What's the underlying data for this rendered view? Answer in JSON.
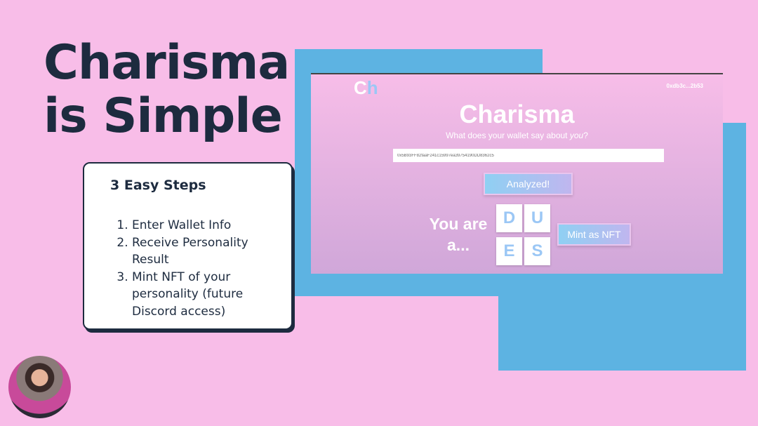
{
  "slide": {
    "title_line1": "Charisma",
    "title_line2": "is Simple",
    "steps_heading": "3 Easy Steps",
    "steps": [
      "Enter Wallet Info",
      "Receive Personality Result",
      "Mint NFT of your personality (future Discord access)"
    ]
  },
  "app": {
    "logo_c": "C",
    "logo_h": "h",
    "wallet_address": "0xdb3c...2b53",
    "title": "Charisma",
    "subtitle_prefix": "What does your wallet say about ",
    "subtitle_em": "you",
    "subtitle_suffix": "?",
    "wallet_input_value": "0x5B93FF82faaF241c15997ea39754190DD8362c5",
    "analyze_button": "Analyzed!",
    "result_label_1": "You are",
    "result_label_2": "a...",
    "letters": [
      "D",
      "U",
      "E",
      "S"
    ],
    "mint_button": "Mint as NFT"
  },
  "colors": {
    "background": "#f8bde8",
    "accent_blue": "#5db3e2",
    "navy": "#1d2b3f"
  }
}
